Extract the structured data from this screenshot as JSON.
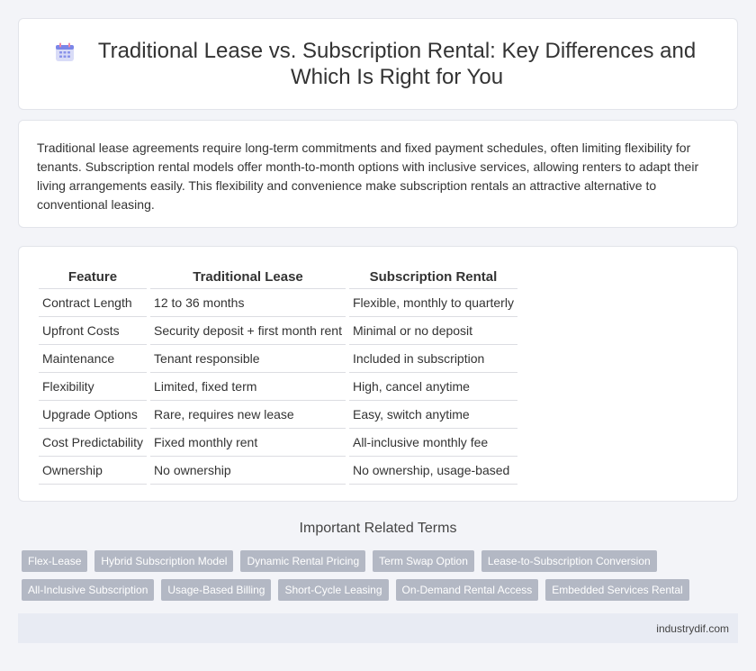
{
  "header": {
    "title": "Traditional Lease vs. Subscription Rental: Key Differences and Which Is Right for You",
    "icon": "calendar-icon"
  },
  "intro": {
    "text": "Traditional lease agreements require long-term commitments and fixed payment schedules, often limiting flexibility for tenants. Subscription rental models offer month-to-month options with inclusive services, allowing renters to adapt their living arrangements easily. This flexibility and convenience make subscription rentals an attractive alternative to conventional leasing."
  },
  "comparison": {
    "headers": [
      "Feature",
      "Traditional Lease",
      "Subscription Rental"
    ],
    "rows": [
      [
        "Contract Length",
        "12 to 36 months",
        "Flexible, monthly to quarterly"
      ],
      [
        "Upfront Costs",
        "Security deposit + first month rent",
        "Minimal or no deposit"
      ],
      [
        "Maintenance",
        "Tenant responsible",
        "Included in subscription"
      ],
      [
        "Flexibility",
        "Limited, fixed term",
        "High, cancel anytime"
      ],
      [
        "Upgrade Options",
        "Rare, requires new lease",
        "Easy, switch anytime"
      ],
      [
        "Cost Predictability",
        "Fixed monthly rent",
        "All-inclusive monthly fee"
      ],
      [
        "Ownership",
        "No ownership",
        "No ownership, usage-based"
      ]
    ]
  },
  "related": {
    "heading": "Important Related Terms",
    "tags": [
      "Flex-Lease",
      "Hybrid Subscription Model",
      "Dynamic Rental Pricing",
      "Term Swap Option",
      "Lease-to-Subscription Conversion",
      "All-Inclusive Subscription",
      "Usage-Based Billing",
      "Short-Cycle Leasing",
      "On-Demand Rental Access",
      "Embedded Services Rental"
    ]
  },
  "footer": {
    "site": "industrydif.com"
  },
  "colors": {
    "tag_bg": "#b3b8c4",
    "footer_bg": "#e8ebf3",
    "page_bg": "#f3f4f8"
  }
}
